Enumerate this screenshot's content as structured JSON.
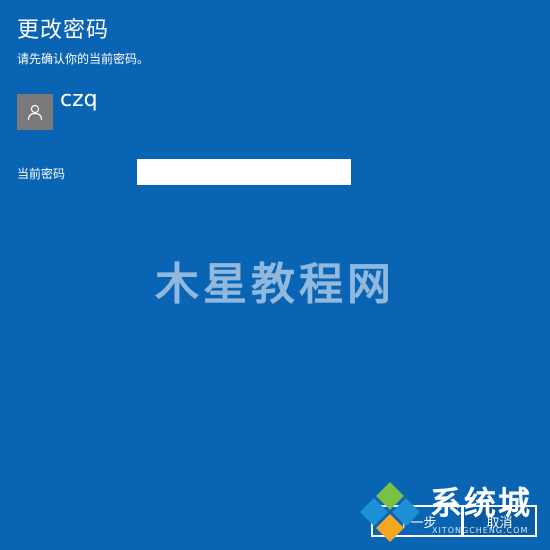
{
  "dialog": {
    "title": "更改密码",
    "subtitle": "请先确认你的当前密码。"
  },
  "account": {
    "username": "czq",
    "avatar_icon": "person-icon"
  },
  "password_field": {
    "label": "当前密码",
    "value": "",
    "placeholder": ""
  },
  "watermark": {
    "text": "木星教程网"
  },
  "buttons": {
    "next_label": "下一步",
    "cancel_label": "取消"
  },
  "logo": {
    "text": "系统城",
    "sub": "XITONGCHENG.COM",
    "icon": "diamond-logo-icon"
  },
  "colors": {
    "background": "#0a64b4",
    "avatar": "#7a7a7a",
    "logo_green": "#7ac143",
    "logo_blue": "#1e90d6"
  }
}
